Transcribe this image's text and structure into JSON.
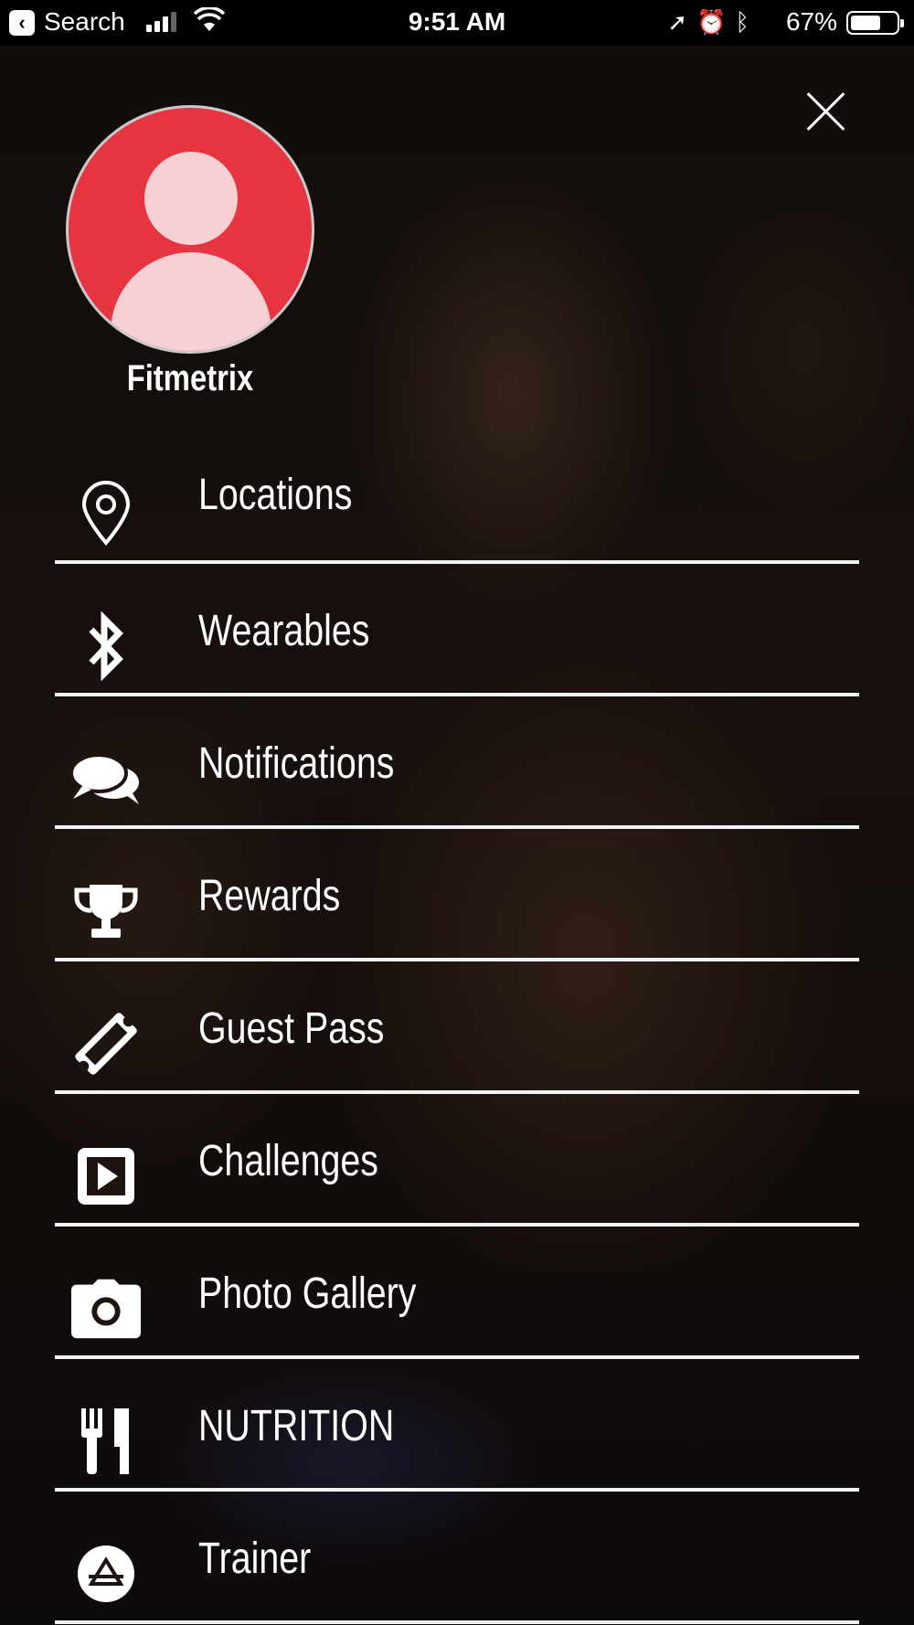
{
  "status_bar": {
    "back_app": "Search",
    "time": "9:51 AM",
    "battery_pct": "67%",
    "battery_level": 0.67
  },
  "profile": {
    "name": "Fitmetrix",
    "avatar_color": "#e63541"
  },
  "menu": {
    "items": [
      {
        "label": "Locations",
        "icon": "location-pin-icon"
      },
      {
        "label": "Wearables",
        "icon": "bluetooth-icon"
      },
      {
        "label": "Notifications",
        "icon": "chat-bubbles-icon"
      },
      {
        "label": "Rewards",
        "icon": "trophy-icon"
      },
      {
        "label": "Guest Pass",
        "icon": "ticket-icon"
      },
      {
        "label": "Challenges",
        "icon": "play-icon"
      },
      {
        "label": "Photo Gallery",
        "icon": "camera-icon"
      },
      {
        "label": "NUTRITION",
        "icon": "utensils-icon"
      },
      {
        "label": "Trainer",
        "icon": "trainer-icon"
      }
    ]
  }
}
